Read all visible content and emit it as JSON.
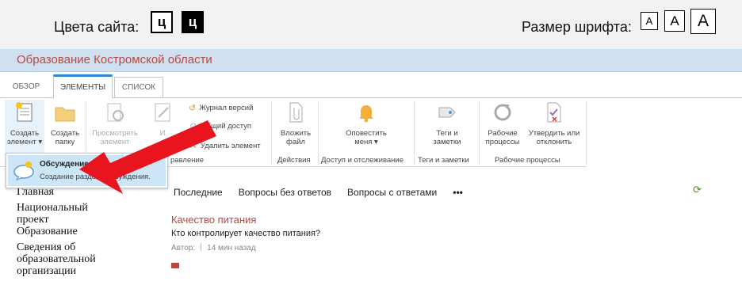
{
  "accessibility": {
    "colors_label": "Цвета сайта:",
    "color_white": "ц",
    "color_black": "ц",
    "font_label": "Размер шрифта:",
    "font_small": "A",
    "font_medium": "A",
    "font_large": "A"
  },
  "site": {
    "title": "Образование Костромской области"
  },
  "tabs": [
    {
      "label": "ОБЗОР"
    },
    {
      "label": "ЭЛЕМЕНТЫ"
    },
    {
      "label": "СПИСОК"
    }
  ],
  "ribbon": {
    "new_item": [
      "Создать",
      "элемент ▾"
    ],
    "new_folder": [
      "Создать",
      "папку"
    ],
    "view": [
      "Просмотреть",
      "элемент"
    ],
    "edit": [
      "И"
    ],
    "version_history": "Журнал версий",
    "shared_access": "Общий доступ",
    "delete_item": "Удалить элемент",
    "group_manage_partial": "равление",
    "attach_file": [
      "Вложить",
      "файл"
    ],
    "group_actions": "Действия",
    "alert_me": [
      "Оповестить",
      "меня ▾"
    ],
    "group_share_track": "Доступ и отслеживание",
    "tags_notes": [
      "Теги и",
      "заметки"
    ],
    "group_tags_notes": "Теги и заметки",
    "workflows": [
      "Рабочие",
      "процессы"
    ],
    "approve_reject": [
      "Утвердить или",
      "отклонить"
    ],
    "group_workflows": "Рабочие процессы"
  },
  "dropdown": {
    "item_title": "Обсуждение",
    "item_desc": "Создание раздела обсуждения."
  },
  "leftnav": [
    "Главная",
    "Национальный проект Образование",
    "Сведения об образовательной организации"
  ],
  "filters": [
    "Последние",
    "Вопросы без ответов",
    "Вопросы с ответами",
    "•••"
  ],
  "post": {
    "title": "Качество питания",
    "question": "Кто контролирует качество питания?",
    "author_label": "Автор:",
    "time": "14 мин назад"
  },
  "colors": {
    "accent": "#2b88d8",
    "title_red": "#b8493c",
    "arrow_red": "#e8141e",
    "bar_blue": "#cfe0f0"
  }
}
